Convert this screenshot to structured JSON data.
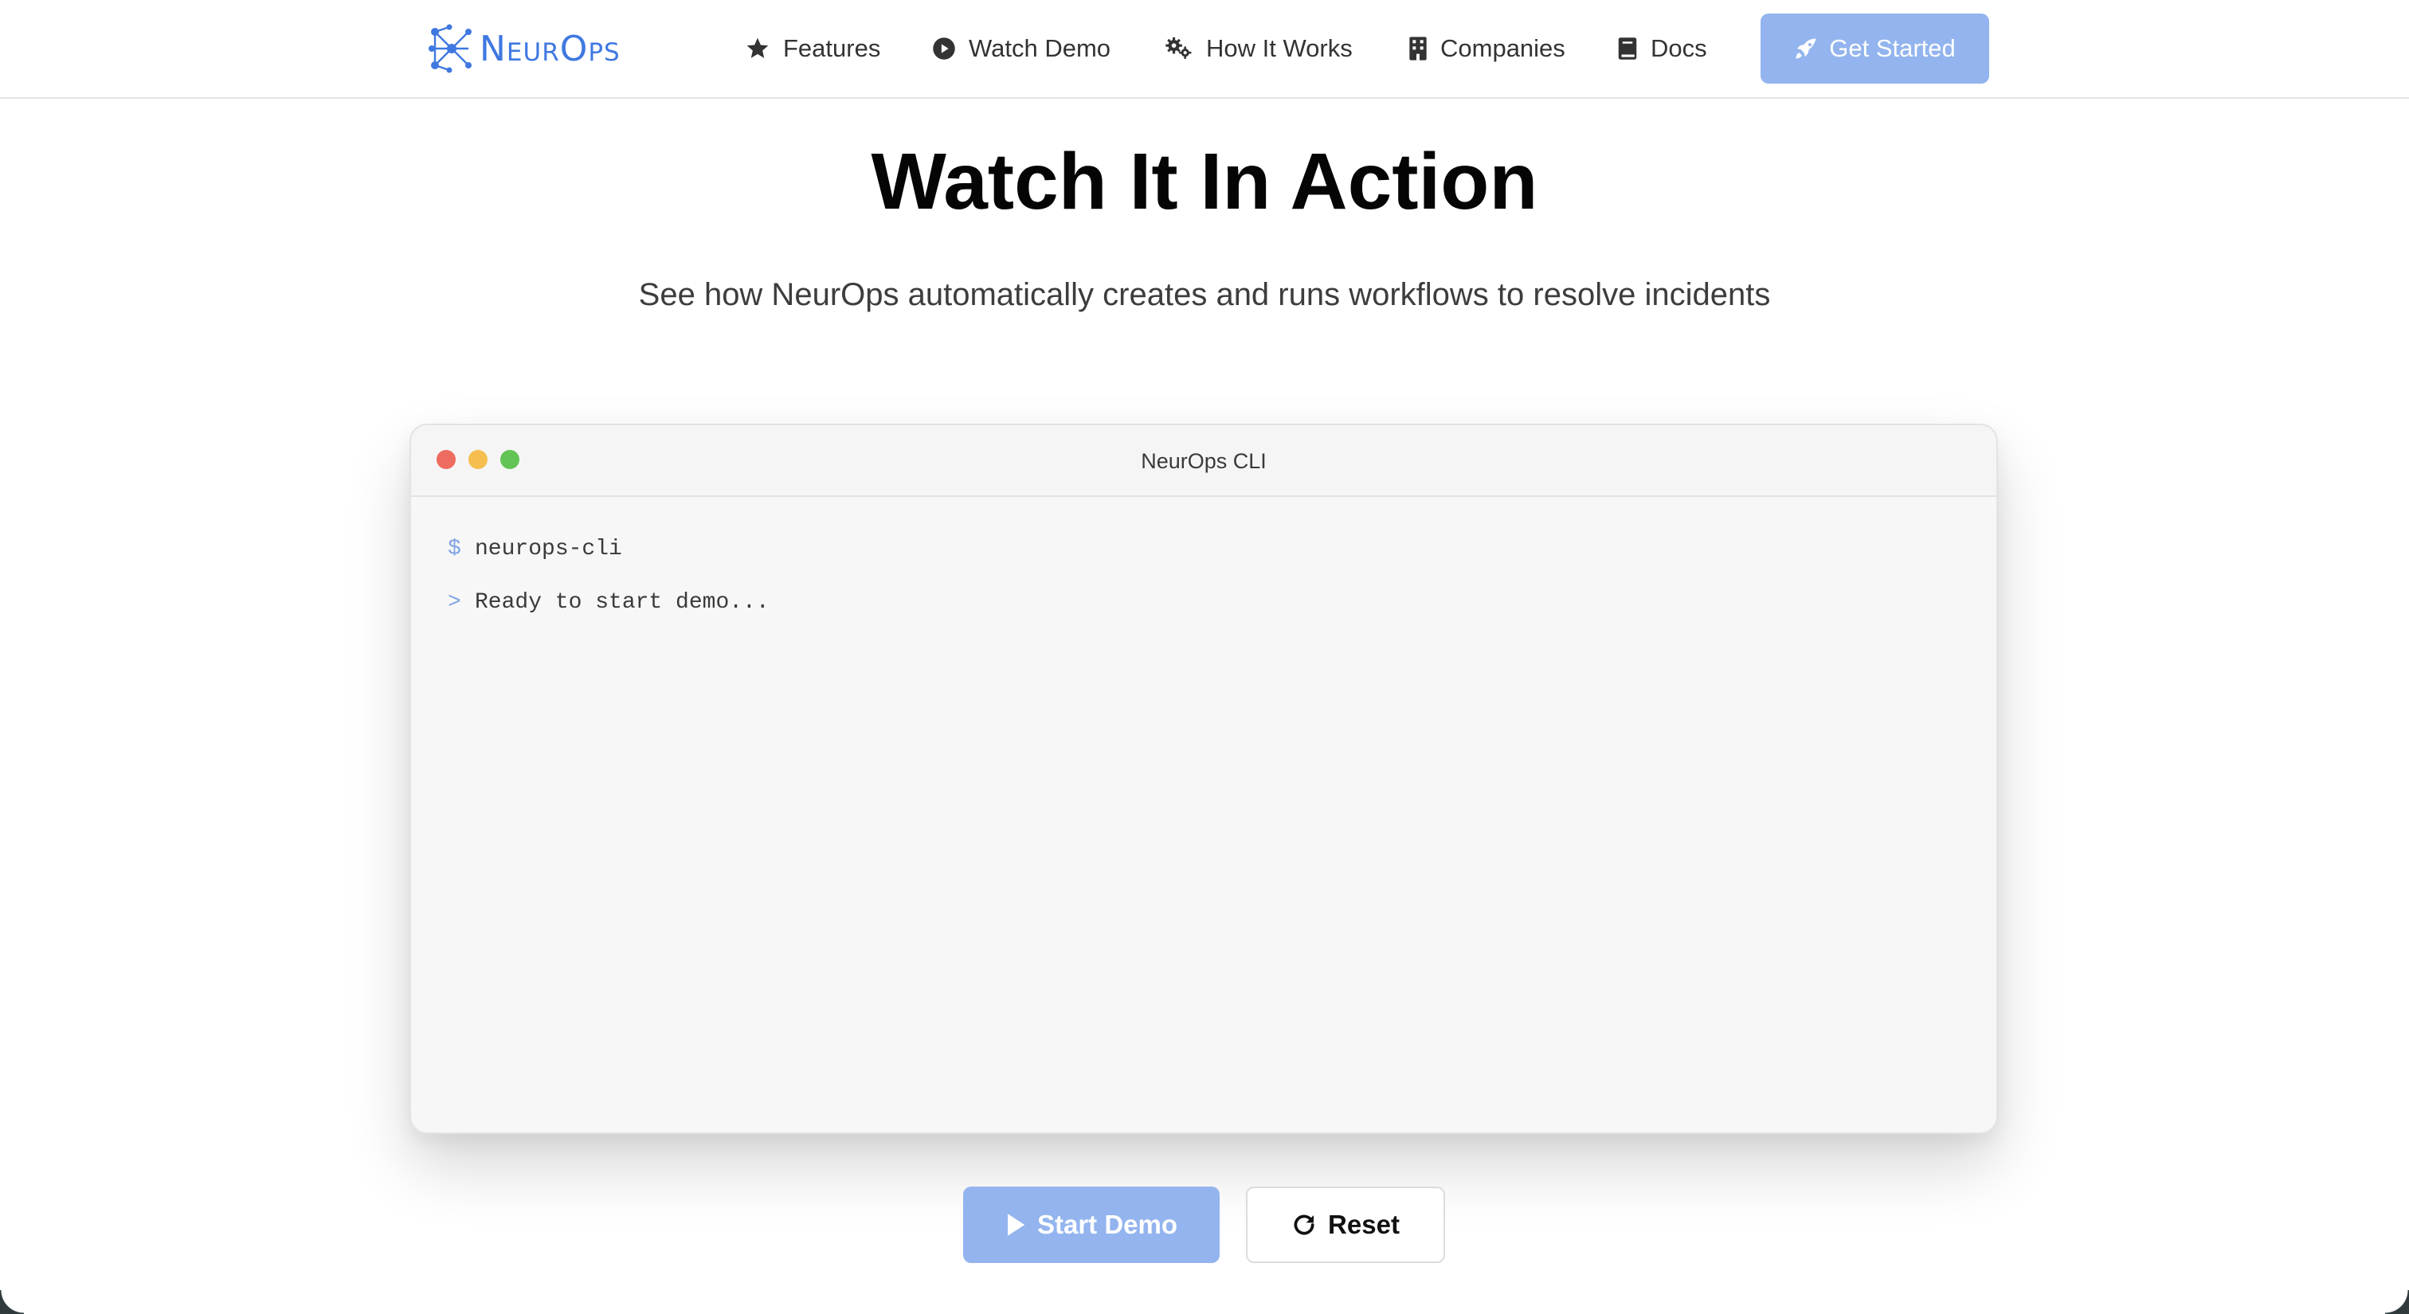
{
  "brand": {
    "name": "NeurOps"
  },
  "nav": {
    "items": [
      {
        "label": "Features",
        "icon": "star-icon"
      },
      {
        "label": "Watch Demo",
        "icon": "play-circle-icon"
      },
      {
        "label": "How It Works",
        "icon": "gears-icon"
      },
      {
        "label": "Companies",
        "icon": "building-icon"
      },
      {
        "label": "Docs",
        "icon": "book-icon"
      }
    ],
    "cta_label": "Get Started",
    "cta_icon": "rocket-icon"
  },
  "hero": {
    "title": "Watch It In Action",
    "subtitle": "See how NeurOps automatically creates and runs workflows to resolve incidents"
  },
  "terminal": {
    "title": "NeurOps CLI",
    "lines": [
      {
        "prompt": "$",
        "text": "neurops-cli"
      },
      {
        "prompt": ">",
        "text": "Ready to start demo..."
      }
    ]
  },
  "controls": {
    "start_label": "Start Demo",
    "reset_label": "Reset"
  },
  "colors": {
    "accent": "#3f78e0",
    "button_primary": "#93b4ee",
    "terminal_bg": "#f7f7f7",
    "dot_red": "#ee6b60",
    "dot_yellow": "#f5be4f",
    "dot_green": "#61c454"
  }
}
